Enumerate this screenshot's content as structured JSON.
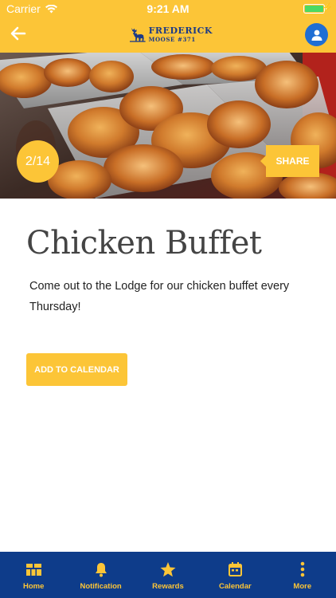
{
  "status_bar": {
    "carrier": "Carrier",
    "time": "9:21 AM"
  },
  "header": {
    "logo_line1": "FREDERICK",
    "logo_line2": "MOOSE #371",
    "back_icon": "arrow-left-icon",
    "profile_icon": "user-icon"
  },
  "hero": {
    "counter": "2/14",
    "share_label": "SHARE"
  },
  "event": {
    "title": "Chicken Buffet",
    "description": "Come out to the Lodge for our chicken buffet every Thursday!",
    "add_to_calendar_label": "ADD TO CALENDAR"
  },
  "tabs": [
    {
      "label": "Home",
      "icon": "grid-icon"
    },
    {
      "label": "Notification",
      "icon": "bell-icon"
    },
    {
      "label": "Rewards",
      "icon": "star-icon"
    },
    {
      "label": "Calendar",
      "icon": "calendar-icon"
    },
    {
      "label": "More",
      "icon": "more-vertical-icon"
    }
  ],
  "colors": {
    "accent": "#fcc537",
    "nav_background": "#0e3c8a",
    "logo_blue": "#1d3b86",
    "avatar_blue": "#1f6ed4"
  }
}
